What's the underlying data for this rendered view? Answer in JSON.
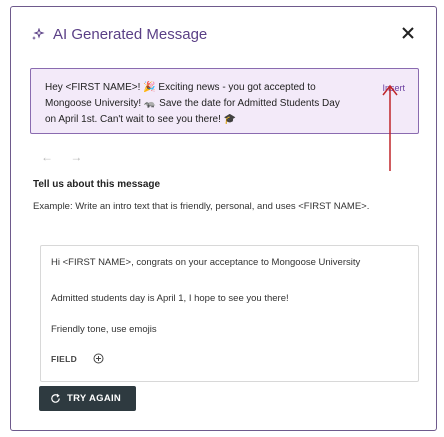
{
  "dialog": {
    "title": "AI Generated Message",
    "title_icon": "sparkle-icon",
    "close_icon": "close-icon"
  },
  "generated_message": {
    "text": "Hey <FIRST NAME>! 🎉 Exciting news - you got accepted to Mongoose University! 🦡 Save the date for Admitted Students Day on April 1st. Can't wait to see you there! 🎓",
    "insert_label": "Insert"
  },
  "navigation": {
    "prev_icon": "arrow-left-icon",
    "next_icon": "arrow-right-icon",
    "prev": "←",
    "next": "→"
  },
  "message_section": {
    "title": "Tell us about this message",
    "example": "Example: Write an intro text that is friendly, personal, and uses <FIRST NAME>."
  },
  "prompt": {
    "line1": "Hi <FIRST NAME>, congrats on your acceptance to Mongoose University",
    "line2": "Admitted students day is April 1, I hope to see you there!",
    "line3": "Friendly tone, use emojis",
    "field_label": "FIELD",
    "field_icon": "plus-circle-icon"
  },
  "actions": {
    "try_again_label": "TRY AGAIN",
    "try_again_icon": "refresh-icon"
  },
  "colors": {
    "accent": "#5a3f86",
    "message_bg": "#f3eaf9",
    "message_border": "#8a6bb0",
    "annotation_arrow": "#c0262b",
    "button_bg": "#2e3a40"
  }
}
